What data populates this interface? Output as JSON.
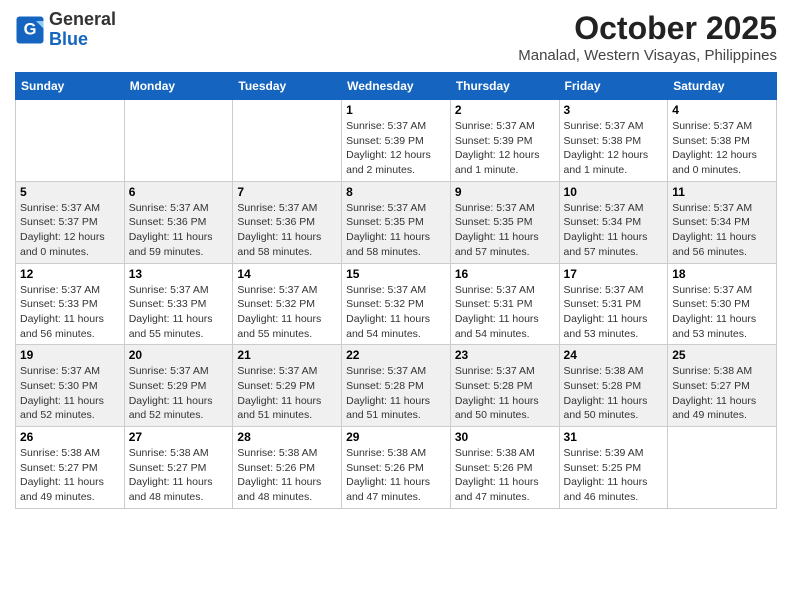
{
  "header": {
    "logo_general": "General",
    "logo_blue": "Blue",
    "month_title": "October 2025",
    "location": "Manalad, Western Visayas, Philippines"
  },
  "days_of_week": [
    "Sunday",
    "Monday",
    "Tuesday",
    "Wednesday",
    "Thursday",
    "Friday",
    "Saturday"
  ],
  "weeks": [
    [
      {
        "day": "",
        "info": ""
      },
      {
        "day": "",
        "info": ""
      },
      {
        "day": "",
        "info": ""
      },
      {
        "day": "1",
        "info": "Sunrise: 5:37 AM\nSunset: 5:39 PM\nDaylight: 12 hours\nand 2 minutes."
      },
      {
        "day": "2",
        "info": "Sunrise: 5:37 AM\nSunset: 5:39 PM\nDaylight: 12 hours\nand 1 minute."
      },
      {
        "day": "3",
        "info": "Sunrise: 5:37 AM\nSunset: 5:38 PM\nDaylight: 12 hours\nand 1 minute."
      },
      {
        "day": "4",
        "info": "Sunrise: 5:37 AM\nSunset: 5:38 PM\nDaylight: 12 hours\nand 0 minutes."
      }
    ],
    [
      {
        "day": "5",
        "info": "Sunrise: 5:37 AM\nSunset: 5:37 PM\nDaylight: 12 hours\nand 0 minutes."
      },
      {
        "day": "6",
        "info": "Sunrise: 5:37 AM\nSunset: 5:36 PM\nDaylight: 11 hours\nand 59 minutes."
      },
      {
        "day": "7",
        "info": "Sunrise: 5:37 AM\nSunset: 5:36 PM\nDaylight: 11 hours\nand 58 minutes."
      },
      {
        "day": "8",
        "info": "Sunrise: 5:37 AM\nSunset: 5:35 PM\nDaylight: 11 hours\nand 58 minutes."
      },
      {
        "day": "9",
        "info": "Sunrise: 5:37 AM\nSunset: 5:35 PM\nDaylight: 11 hours\nand 57 minutes."
      },
      {
        "day": "10",
        "info": "Sunrise: 5:37 AM\nSunset: 5:34 PM\nDaylight: 11 hours\nand 57 minutes."
      },
      {
        "day": "11",
        "info": "Sunrise: 5:37 AM\nSunset: 5:34 PM\nDaylight: 11 hours\nand 56 minutes."
      }
    ],
    [
      {
        "day": "12",
        "info": "Sunrise: 5:37 AM\nSunset: 5:33 PM\nDaylight: 11 hours\nand 56 minutes."
      },
      {
        "day": "13",
        "info": "Sunrise: 5:37 AM\nSunset: 5:33 PM\nDaylight: 11 hours\nand 55 minutes."
      },
      {
        "day": "14",
        "info": "Sunrise: 5:37 AM\nSunset: 5:32 PM\nDaylight: 11 hours\nand 55 minutes."
      },
      {
        "day": "15",
        "info": "Sunrise: 5:37 AM\nSunset: 5:32 PM\nDaylight: 11 hours\nand 54 minutes."
      },
      {
        "day": "16",
        "info": "Sunrise: 5:37 AM\nSunset: 5:31 PM\nDaylight: 11 hours\nand 54 minutes."
      },
      {
        "day": "17",
        "info": "Sunrise: 5:37 AM\nSunset: 5:31 PM\nDaylight: 11 hours\nand 53 minutes."
      },
      {
        "day": "18",
        "info": "Sunrise: 5:37 AM\nSunset: 5:30 PM\nDaylight: 11 hours\nand 53 minutes."
      }
    ],
    [
      {
        "day": "19",
        "info": "Sunrise: 5:37 AM\nSunset: 5:30 PM\nDaylight: 11 hours\nand 52 minutes."
      },
      {
        "day": "20",
        "info": "Sunrise: 5:37 AM\nSunset: 5:29 PM\nDaylight: 11 hours\nand 52 minutes."
      },
      {
        "day": "21",
        "info": "Sunrise: 5:37 AM\nSunset: 5:29 PM\nDaylight: 11 hours\nand 51 minutes."
      },
      {
        "day": "22",
        "info": "Sunrise: 5:37 AM\nSunset: 5:28 PM\nDaylight: 11 hours\nand 51 minutes."
      },
      {
        "day": "23",
        "info": "Sunrise: 5:37 AM\nSunset: 5:28 PM\nDaylight: 11 hours\nand 50 minutes."
      },
      {
        "day": "24",
        "info": "Sunrise: 5:38 AM\nSunset: 5:28 PM\nDaylight: 11 hours\nand 50 minutes."
      },
      {
        "day": "25",
        "info": "Sunrise: 5:38 AM\nSunset: 5:27 PM\nDaylight: 11 hours\nand 49 minutes."
      }
    ],
    [
      {
        "day": "26",
        "info": "Sunrise: 5:38 AM\nSunset: 5:27 PM\nDaylight: 11 hours\nand 49 minutes."
      },
      {
        "day": "27",
        "info": "Sunrise: 5:38 AM\nSunset: 5:27 PM\nDaylight: 11 hours\nand 48 minutes."
      },
      {
        "day": "28",
        "info": "Sunrise: 5:38 AM\nSunset: 5:26 PM\nDaylight: 11 hours\nand 48 minutes."
      },
      {
        "day": "29",
        "info": "Sunrise: 5:38 AM\nSunset: 5:26 PM\nDaylight: 11 hours\nand 47 minutes."
      },
      {
        "day": "30",
        "info": "Sunrise: 5:38 AM\nSunset: 5:26 PM\nDaylight: 11 hours\nand 47 minutes."
      },
      {
        "day": "31",
        "info": "Sunrise: 5:39 AM\nSunset: 5:25 PM\nDaylight: 11 hours\nand 46 minutes."
      },
      {
        "day": "",
        "info": ""
      }
    ]
  ]
}
